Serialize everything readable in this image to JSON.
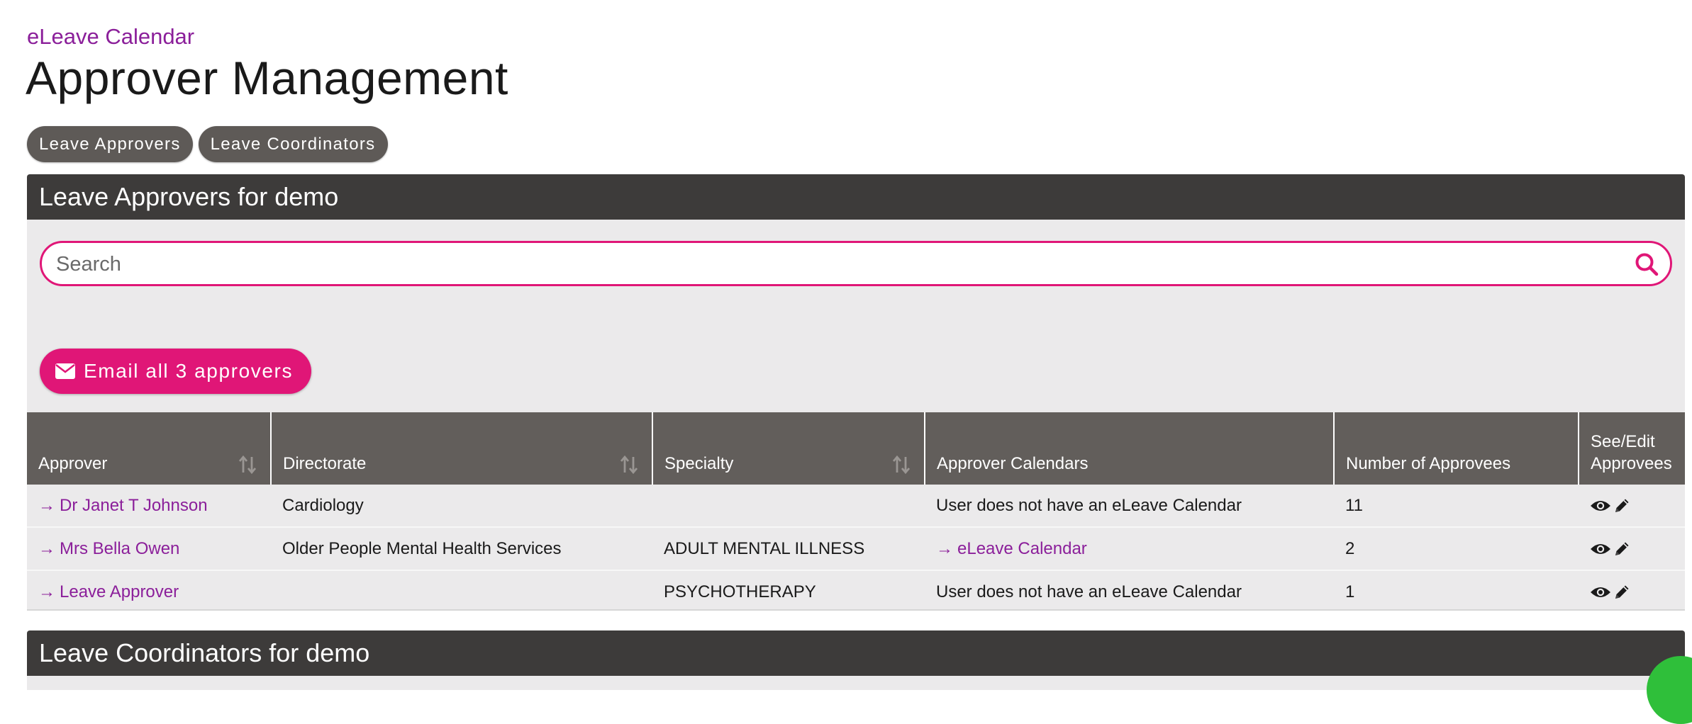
{
  "breadcrumb": "eLeave Calendar",
  "page_title": "Approver Management",
  "tabs": [
    {
      "label": "Leave Approvers"
    },
    {
      "label": "Leave Coordinators"
    }
  ],
  "approvers_panel": {
    "title": "Leave Approvers for demo",
    "search_placeholder": "Search",
    "email_button_label": "Email all 3 approvers"
  },
  "table": {
    "columns": [
      "Approver",
      "Directorate",
      "Specialty",
      "Approver Calendars",
      "Number of Approvees",
      "See/Edit Approvees"
    ],
    "rows": [
      {
        "approver": "Dr Janet T Johnson",
        "directorate": "Cardiology",
        "specialty": "",
        "calendar": "User does not have an eLeave Calendar",
        "calendar_is_link": false,
        "approvees": "11"
      },
      {
        "approver": "Mrs Bella Owen",
        "directorate": "Older People Mental Health Services",
        "specialty": "ADULT MENTAL ILLNESS",
        "calendar": "eLeave Calendar",
        "calendar_is_link": true,
        "approvees": "2"
      },
      {
        "approver": "Leave Approver",
        "directorate": "",
        "specialty": "PSYCHOTHERAPY",
        "calendar": "User does not have an eLeave Calendar",
        "calendar_is_link": false,
        "approvees": "1"
      }
    ]
  },
  "coordinators_panel": {
    "title": "Leave Coordinators for demo"
  },
  "colors": {
    "accent": "#e01677",
    "link": "#8b1f9a",
    "header_dark": "#3d3b3a",
    "table_header": "#625e5b",
    "panel_bg": "#ebeaeb"
  }
}
